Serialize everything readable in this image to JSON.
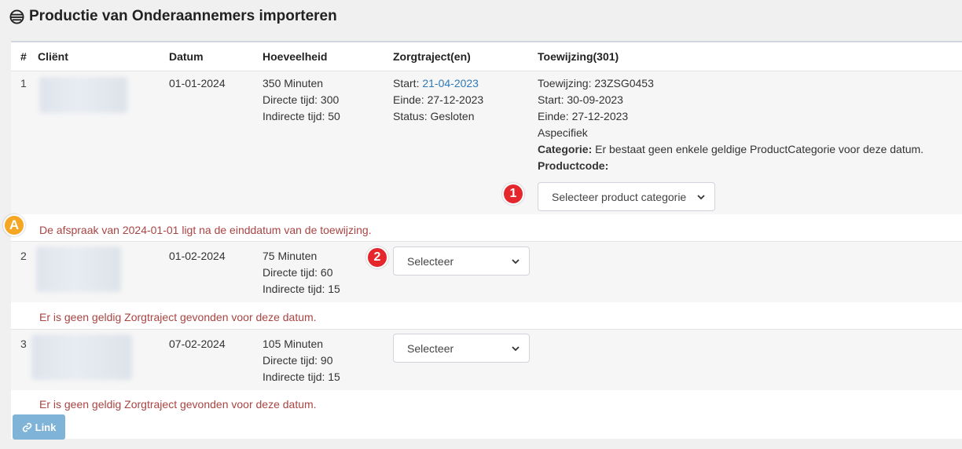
{
  "page": {
    "title": "Productie van Onderaannemers importeren"
  },
  "table": {
    "headers": {
      "index": "#",
      "client": "Cliënt",
      "datum": "Datum",
      "hoeveelheid": "Hoeveelheid",
      "zorgtraject": "Zorgtraject(en)",
      "toewijzing": "Toewijzing(301)"
    },
    "rows": [
      {
        "index": "1",
        "datum": "01-01-2024",
        "hoeveelheid": "350 Minuten",
        "directe": "Directe tijd: 300",
        "indirecte": "Indirecte tijd: 50",
        "start_label": "Start: ",
        "start_link": "21-04-2023",
        "einde": "Einde: 27-12-2023",
        "status": "Status: Gesloten",
        "toewijzing": "Toewijzing: 23ZSG0453",
        "tw_start": "Start: 30-09-2023",
        "tw_einde": "Einde: 27-12-2023",
        "tw_type": "Aspecifiek",
        "categorie_label": "Categorie:",
        "categorie_text": " Er bestaat geen enkele geldige ProductCategorie voor deze datum.",
        "productcode_label": "Productcode:",
        "product_select": "Selecteer product categorie",
        "error": "De afspraak van 2024-01-01 ligt na de einddatum van de toewijzing."
      },
      {
        "index": "2",
        "datum": "01-02-2024",
        "hoeveelheid": "75 Minuten",
        "directe": "Directe tijd: 60",
        "indirecte": "Indirecte tijd: 15",
        "select": "Selecteer",
        "error": "Er is geen geldig Zorgtraject gevonden voor deze datum."
      },
      {
        "index": "3",
        "datum": "07-02-2024",
        "hoeveelheid": "105 Minuten",
        "directe": "Directe tijd: 90",
        "indirecte": "Indirecte tijd: 15",
        "select": "Selecteer",
        "error": "Er is geen geldig Zorgtraject gevonden voor deze datum."
      }
    ]
  },
  "annotations": {
    "badge1": "1",
    "badge2": "2",
    "badgeA": "A"
  },
  "buttons": {
    "link": "Link"
  },
  "colors": {
    "link": "#2f7ab8",
    "error": "#a94442",
    "badge_red": "#e5262d",
    "badge_yellow": "#f5a623",
    "button": "#7fb3d8"
  }
}
